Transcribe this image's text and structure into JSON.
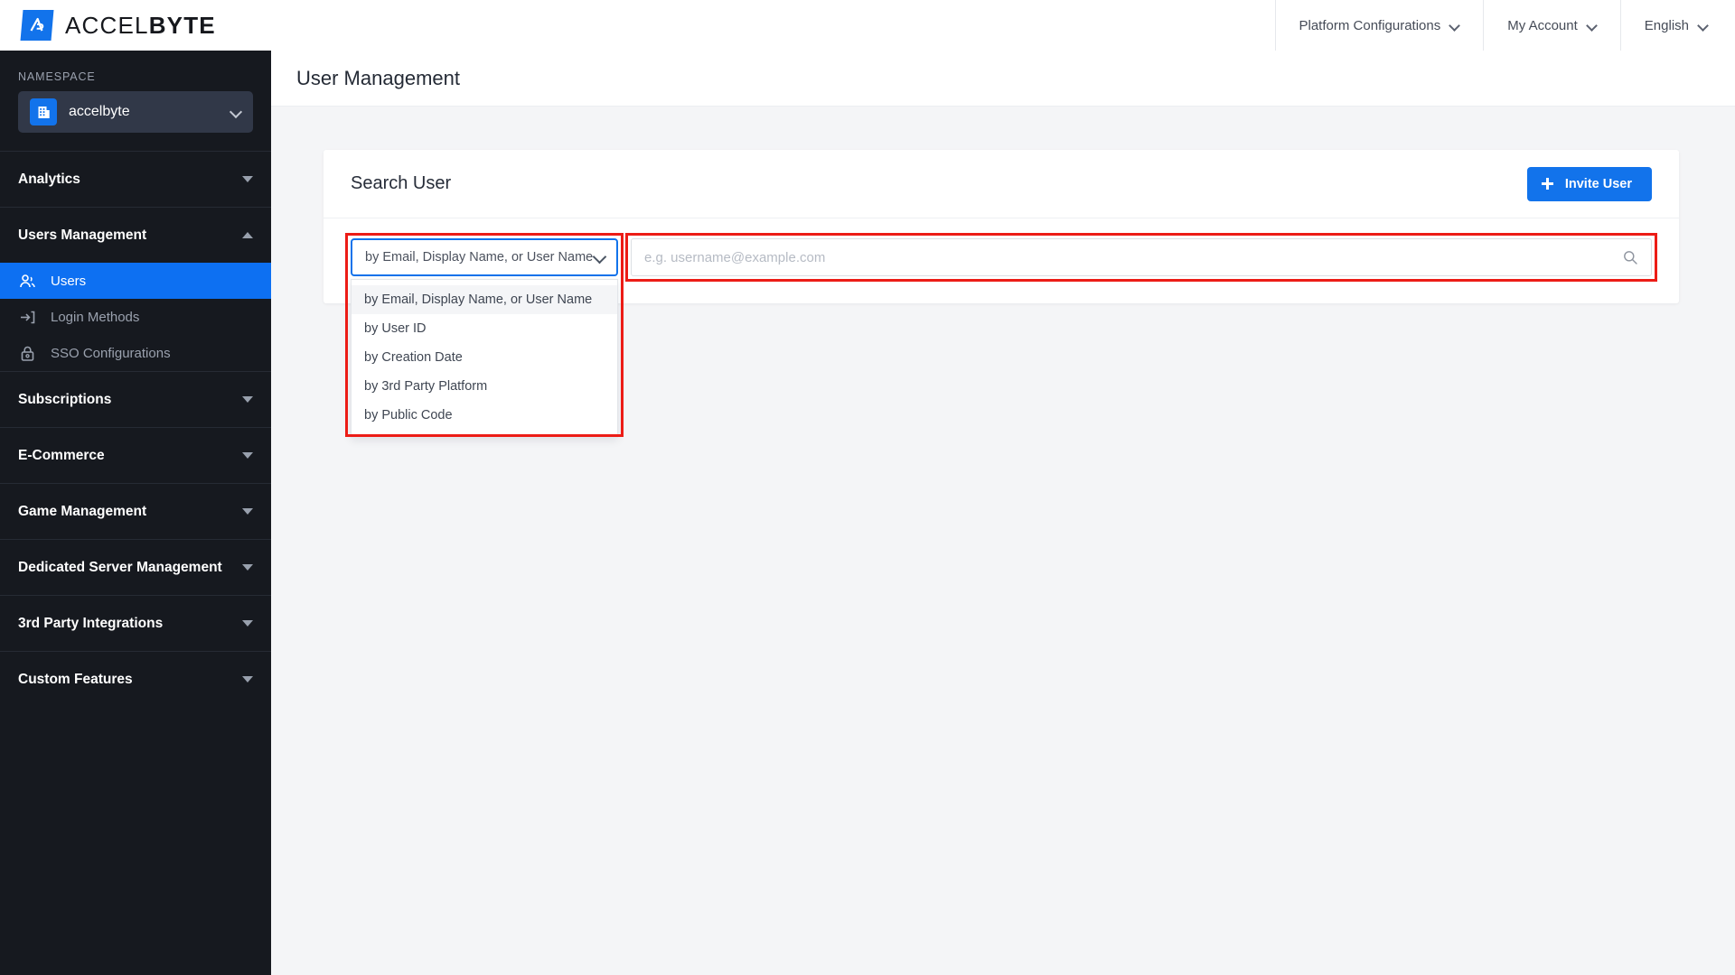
{
  "brand": {
    "name_light": "ACCEL",
    "name_bold": "BYTE",
    "logo_icon": "accelbyte-logo-icon"
  },
  "topnav": {
    "items": [
      {
        "label": "Platform Configurations",
        "icon": "chevron-down-icon"
      },
      {
        "label": "My Account",
        "icon": "chevron-down-icon"
      },
      {
        "label": "English",
        "icon": "chevron-down-icon"
      }
    ]
  },
  "sidebar": {
    "namespace_label": "NAMESPACE",
    "namespace_value": "accelbyte",
    "namespace_icon": "building-icon",
    "namespace_chevron": "chevron-down-icon",
    "sections": [
      {
        "label": "Analytics",
        "expanded": false,
        "caret": "caret-down-icon"
      },
      {
        "label": "Users Management",
        "expanded": true,
        "caret": "caret-up-icon"
      },
      {
        "label": "Subscriptions",
        "expanded": false,
        "caret": "caret-down-icon"
      },
      {
        "label": "E-Commerce",
        "expanded": false,
        "caret": "caret-down-icon"
      },
      {
        "label": "Game Management",
        "expanded": false,
        "caret": "caret-down-icon"
      },
      {
        "label": "Dedicated Server Management",
        "expanded": false,
        "caret": "caret-down-icon"
      },
      {
        "label": "3rd Party Integrations",
        "expanded": false,
        "caret": "caret-down-icon"
      },
      {
        "label": "Custom Features",
        "expanded": false,
        "caret": "caret-down-icon"
      }
    ],
    "users_management_items": [
      {
        "label": "Users",
        "icon": "users-icon",
        "active": true
      },
      {
        "label": "Login Methods",
        "icon": "login-arrow-icon",
        "active": false
      },
      {
        "label": "SSO Configurations",
        "icon": "lock-icon",
        "active": false
      }
    ]
  },
  "page": {
    "title": "User Management"
  },
  "card": {
    "title": "Search User",
    "invite_button": "Invite User",
    "invite_icon": "plus-icon"
  },
  "search": {
    "select_value": "by Email, Display Name, or User Name",
    "select_icon": "chevron-down-icon",
    "input_placeholder": "e.g. username@example.com",
    "input_value": "",
    "search_icon": "search-icon",
    "options": [
      "by Email, Display Name, or User Name",
      "by User ID",
      "by Creation Date",
      "by 3rd Party Platform",
      "by Public Code"
    ],
    "highlighted_option_index": 0
  },
  "annotations": {
    "color": "#ec1c16",
    "boxes": [
      "search-type-select-annotation",
      "search-input-annotation"
    ]
  },
  "colors": {
    "accent_blue": "#1273eb",
    "active_nav_blue": "#0d70f2",
    "sidebar_bg": "#16191f",
    "page_bg": "#f4f5f7",
    "annotation_red": "#ec1c16"
  }
}
